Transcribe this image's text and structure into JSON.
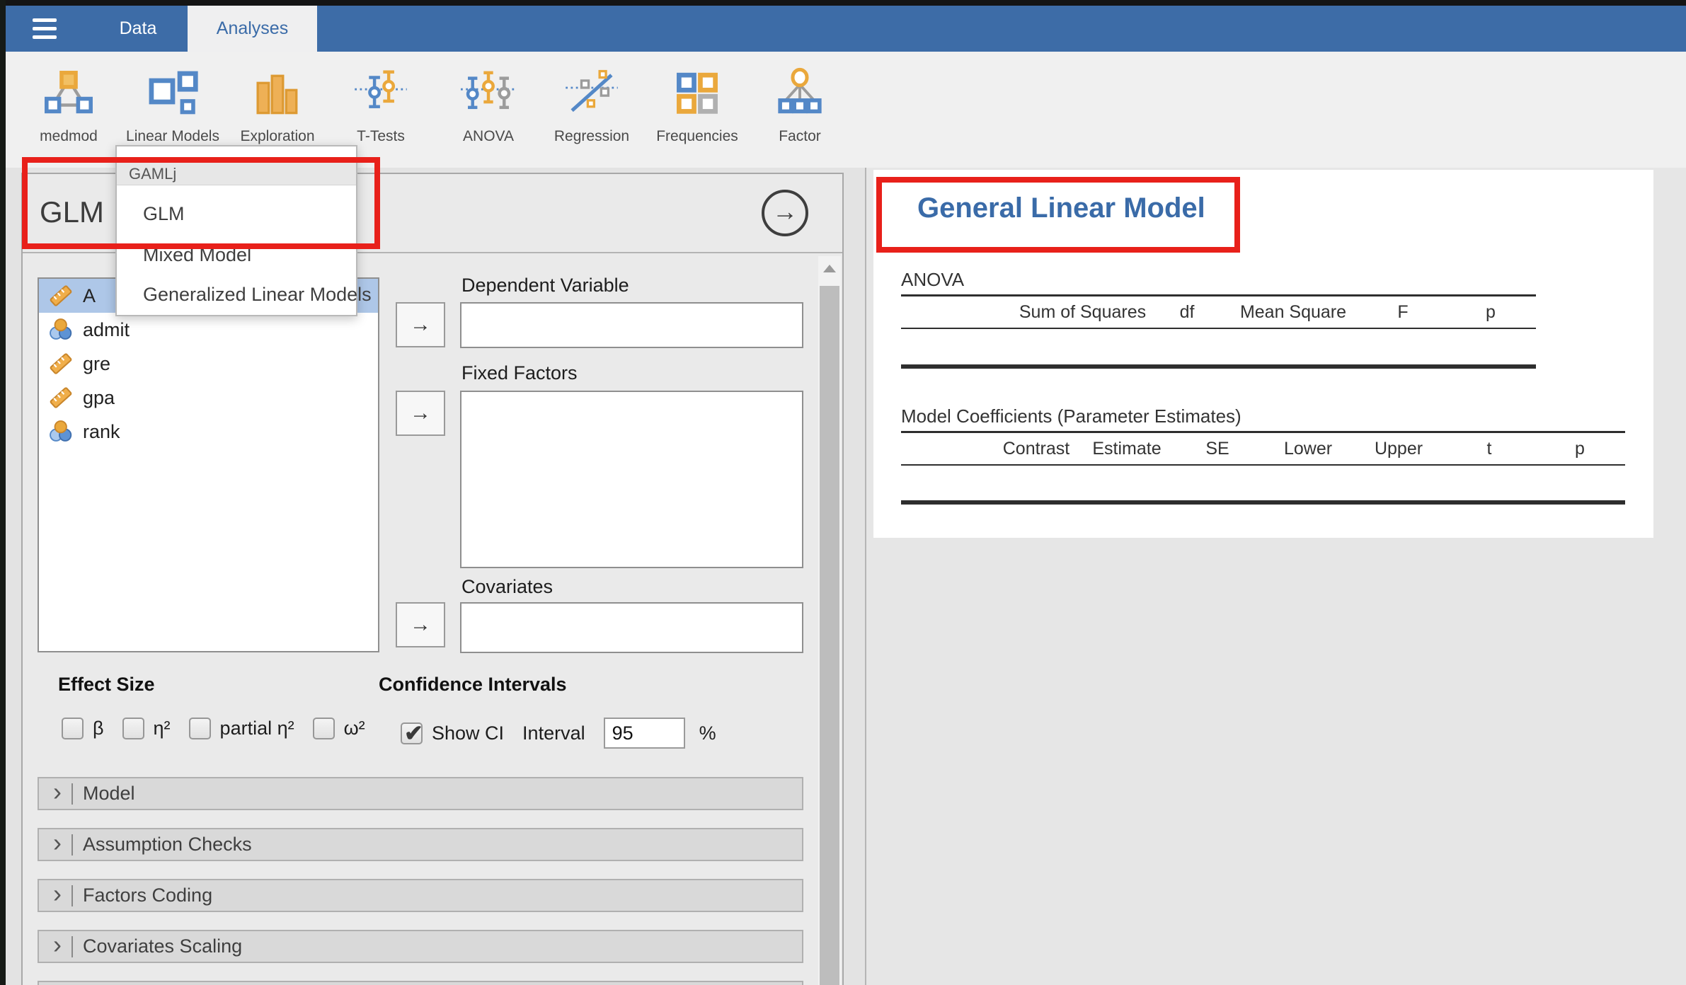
{
  "header": {
    "tabs": [
      {
        "label": "Data",
        "active": false
      },
      {
        "label": "Analyses",
        "active": true
      }
    ]
  },
  "ribbon": {
    "items": [
      {
        "label": "medmod",
        "icon": "medmod-icon"
      },
      {
        "label": "Linear Models",
        "icon": "linear-models-icon"
      },
      {
        "label": "Exploration",
        "icon": "exploration-icon"
      },
      {
        "label": "T-Tests",
        "icon": "t-tests-icon"
      },
      {
        "label": "ANOVA",
        "icon": "anova-icon"
      },
      {
        "label": "Regression",
        "icon": "regression-icon"
      },
      {
        "label": "Frequencies",
        "icon": "frequencies-icon"
      },
      {
        "label": "Factor",
        "icon": "factor-icon"
      }
    ]
  },
  "dropdown": {
    "group": "GAMLj",
    "items": [
      {
        "label": "GLM"
      },
      {
        "label": "Mixed Model"
      },
      {
        "label": "Generalized Linear Models"
      }
    ]
  },
  "panel": {
    "title": "GLM",
    "variables": [
      {
        "name": "A",
        "type": "continuous",
        "selected": true
      },
      {
        "name": "admit",
        "type": "nominal",
        "selected": false
      },
      {
        "name": "gre",
        "type": "continuous",
        "selected": false
      },
      {
        "name": "gpa",
        "type": "continuous",
        "selected": false
      },
      {
        "name": "rank",
        "type": "nominal",
        "selected": false
      }
    ],
    "fields": [
      {
        "label": "Dependent Variable"
      },
      {
        "label": "Fixed Factors"
      },
      {
        "label": "Covariates"
      }
    ],
    "effect_size": {
      "label": "Effect Size",
      "options": [
        {
          "label": "β",
          "checked": false
        },
        {
          "label": "η²",
          "checked": false
        },
        {
          "label": "partial η²",
          "checked": false
        },
        {
          "label": "ω²",
          "checked": false
        }
      ]
    },
    "confidence": {
      "label": "Confidence Intervals",
      "show_ci_label": "Show CI",
      "show_ci_checked": true,
      "interval_label": "Interval",
      "interval_value": "95",
      "percent_label": "%"
    },
    "sections": [
      {
        "label": "Model"
      },
      {
        "label": "Assumption Checks"
      },
      {
        "label": "Factors Coding"
      },
      {
        "label": "Covariates Scaling"
      }
    ]
  },
  "results": {
    "title": "General Linear Model",
    "tables": [
      {
        "title": "ANOVA",
        "columns": [
          "",
          "Sum of Squares",
          "df",
          "Mean Square",
          "F",
          "p"
        ],
        "rows": []
      },
      {
        "title": "Model Coefficients (Parameter Estimates)",
        "columns": [
          "",
          "Contrast",
          "Estimate",
          "SE",
          "Lower",
          "Upper",
          "t",
          "p"
        ],
        "rows": []
      }
    ]
  },
  "annotations": {
    "highlight_box_color": "#e8201a",
    "accent_blue": "#3a6ba8",
    "topbar_blue": "#3d6ca7"
  }
}
